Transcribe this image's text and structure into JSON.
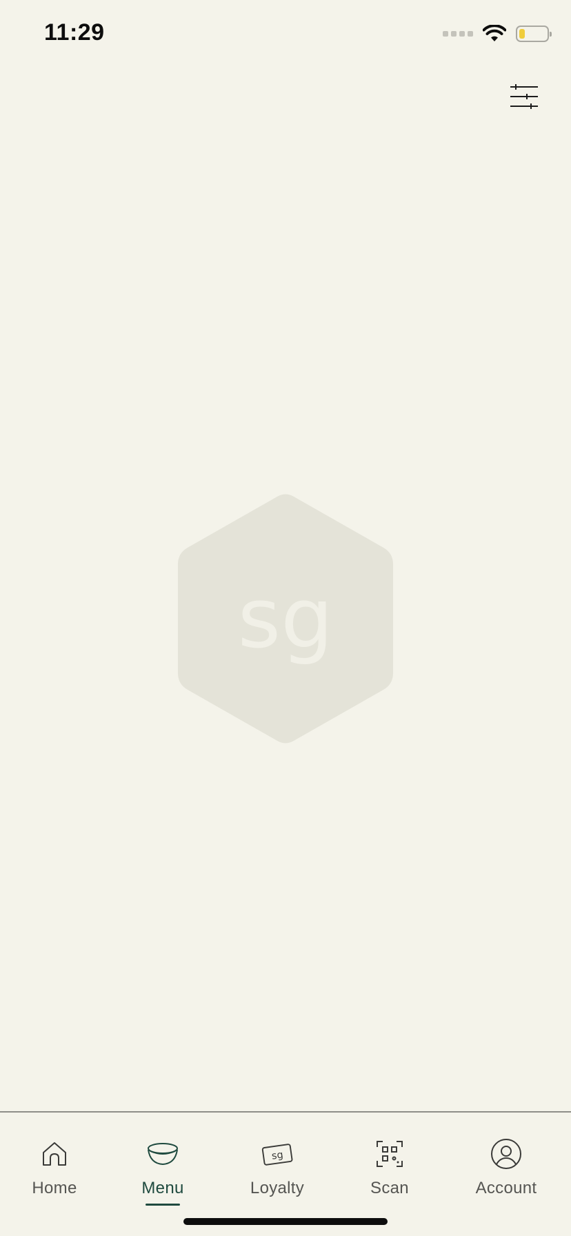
{
  "status_bar": {
    "time": "11:29",
    "icons": [
      "cellular-signal-icon",
      "wifi-icon",
      "battery-icon"
    ],
    "battery_color": "#f0cd3c"
  },
  "header": {
    "filter_icon": "sliders-icon"
  },
  "placeholder": {
    "logo_text": "sg",
    "hex_color": "#e4e3d8",
    "text_color": "#f1f0e7"
  },
  "tab_bar": {
    "active_color": "#1f4a3f",
    "items": [
      {
        "label": "Home",
        "icon": "home-icon",
        "active": false
      },
      {
        "label": "Menu",
        "icon": "bowl-icon",
        "active": true
      },
      {
        "label": "Loyalty",
        "icon": "loyalty-card-icon",
        "active": false
      },
      {
        "label": "Scan",
        "icon": "qr-scan-icon",
        "active": false
      },
      {
        "label": "Account",
        "icon": "account-icon",
        "active": false
      }
    ]
  }
}
